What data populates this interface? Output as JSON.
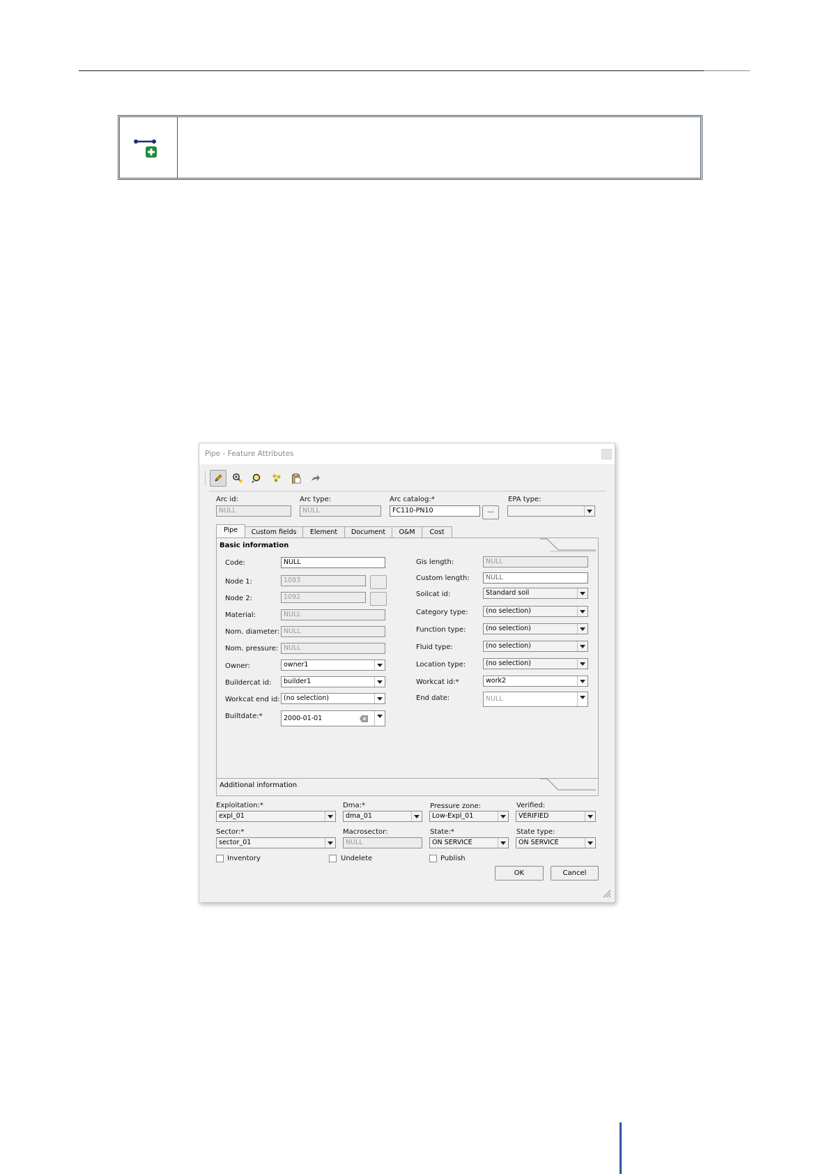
{
  "dialog": {
    "title": "Pipe - Feature Attributes",
    "top_fields": {
      "arc_id": {
        "label": "Arc id:",
        "value": "NULL"
      },
      "arc_type": {
        "label": "Arc type:",
        "value": "NULL"
      },
      "arc_catalog": {
        "label": "Arc catalog:*",
        "value": "FC110-PN10",
        "button": "..."
      },
      "epa_type": {
        "label": "EPA type:",
        "value": ""
      }
    },
    "tabs": [
      "Pipe",
      "Custom fields",
      "Element",
      "Document",
      "O&M",
      "Cost"
    ],
    "active_tab": "Pipe",
    "basic_info_title": "Basic information",
    "left": {
      "code": {
        "label": "Code:",
        "value": "NULL"
      },
      "node1": {
        "label": "Node 1:",
        "value": "1083"
      },
      "node2": {
        "label": "Node 2:",
        "value": "1092"
      },
      "material": {
        "label": "Material:",
        "value": "NULL"
      },
      "nom_diameter": {
        "label": "Nom. diameter:",
        "value": "NULL"
      },
      "nom_pressure": {
        "label": "Nom. pressure:",
        "value": "NULL"
      },
      "owner": {
        "label": "Owner:",
        "value": "owner1"
      },
      "buildercat": {
        "label": "Buildercat id:",
        "value": "builder1"
      },
      "workcat_end": {
        "label": "Workcat end id:",
        "value": "(no selection)"
      },
      "builtdate": {
        "label": "Builtdate:*",
        "value": "2000-01-01"
      }
    },
    "right": {
      "gis_length": {
        "label": "Gis length:",
        "value": "NULL"
      },
      "custom_length": {
        "label": "Custom length:",
        "value": "NULL"
      },
      "soilcat": {
        "label": "Soilcat id:",
        "value": "Standard soil"
      },
      "category_type": {
        "label": "Category type:",
        "value": "(no selection)"
      },
      "function_type": {
        "label": "Function type:",
        "value": "(no selection)"
      },
      "fluid_type": {
        "label": "Fluid type:",
        "value": "(no selection)"
      },
      "location_type": {
        "label": "Location type:",
        "value": "(no selection)"
      },
      "workcat": {
        "label": "Workcat id:*",
        "value": "work2"
      },
      "end_date": {
        "label": "End date:",
        "value": "NULL"
      }
    },
    "additional_info_title": "Additional information",
    "bottom": {
      "exploitation": {
        "label": "Exploitation:*",
        "value": "expl_01"
      },
      "dma": {
        "label": "Dma:*",
        "value": "dma_01"
      },
      "pressure_zone": {
        "label": "Pressure zone:",
        "value": "Low-Expl_01"
      },
      "verified": {
        "label": "Verified:",
        "value": "VERIFIED"
      },
      "sector": {
        "label": "Sector:*",
        "value": "sector_01"
      },
      "macrosector": {
        "label": "Macrosector:",
        "value": "NULL"
      },
      "state": {
        "label": "State:*",
        "value": "ON SERVICE"
      },
      "state_type": {
        "label": "State type:",
        "value": "ON SERVICE"
      }
    },
    "checkboxes": {
      "inventory": "Inventory",
      "undelete": "Undelete",
      "publish": "Publish"
    },
    "buttons": {
      "ok": "OK",
      "cancel": "Cancel"
    }
  },
  "colors": {
    "icon_line": "#1f2a7a",
    "icon_plus": "#1e8c3a",
    "footer_rule": "#2f52a6"
  }
}
